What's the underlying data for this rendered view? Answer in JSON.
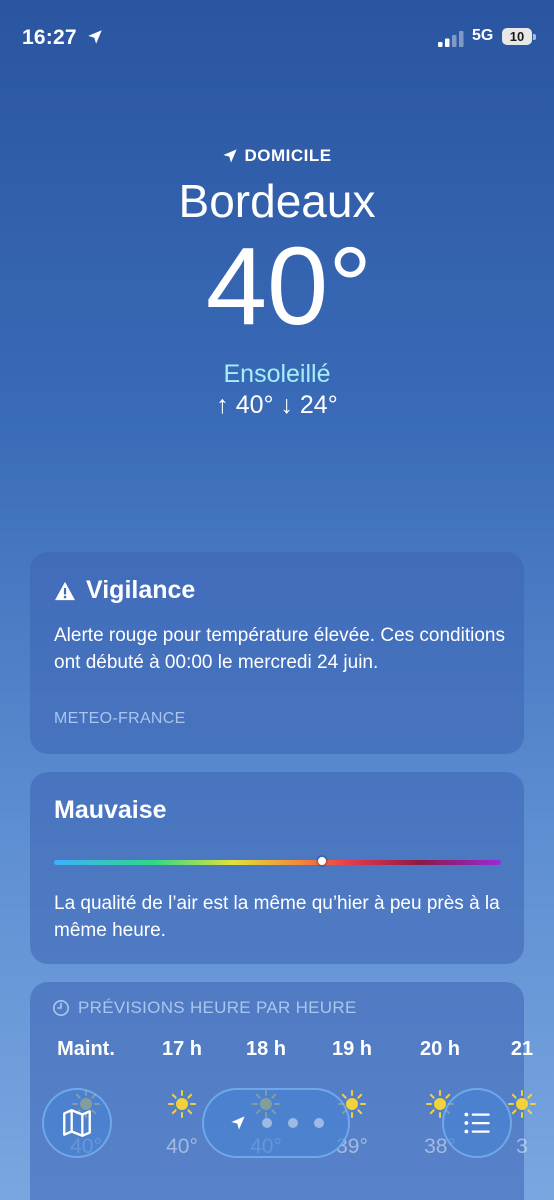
{
  "status_bar": {
    "time": "16:27",
    "network": "5G",
    "battery": "10"
  },
  "header": {
    "location_label": "DOMICILE",
    "city": "Bordeaux",
    "temperature": "40°",
    "condition": "Ensoleillé",
    "high_low": "↑ 40°  ↓ 24°"
  },
  "vigilance_card": {
    "title": "Vigilance",
    "text": "Alerte rouge pour température élevée. Ces conditions ont débuté à 00:00 le mercredi 24 juin.",
    "source": "METEO-FRANCE"
  },
  "air_quality_card": {
    "title": "Mauvaise",
    "level_fraction": 0.6,
    "text": "La qualité de l’air est la même qu’hier à peu près à la même heure."
  },
  "hourly_card": {
    "title": "PRÉVISIONS HEURE PAR HEURE",
    "hours": [
      {
        "label": "Maint.",
        "temp": "40°"
      },
      {
        "label": "17 h",
        "temp": "40°"
      },
      {
        "label": "18 h",
        "temp": "40°"
      },
      {
        "label": "19 h",
        "temp": "39°"
      },
      {
        "label": "20 h",
        "temp": "38°"
      },
      {
        "label": "21",
        "temp": "3"
      }
    ]
  },
  "colors": {
    "accent_condition": "#a6eef8",
    "secondary_text": "#a9c6ef",
    "sun_icon": "#f2d23a"
  },
  "icons": {
    "location": "location-arrow-icon",
    "warning": "warning-triangle-icon",
    "clock": "clock-icon",
    "sun": "sun-icon",
    "map": "map-icon",
    "list": "list-icon"
  }
}
